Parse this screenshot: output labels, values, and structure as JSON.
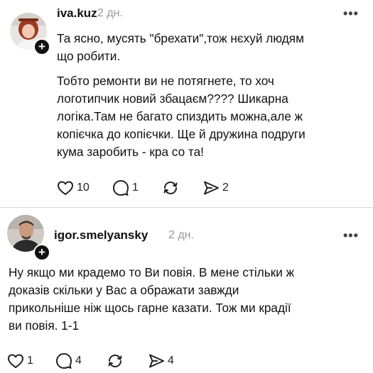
{
  "posts": [
    {
      "username": "iva.kuz",
      "time": "2 дн.",
      "more_label": "•••",
      "avatar_icon": "avatar-icon",
      "paragraphs": [
        [
          "Та ясно, мусять \"брехати\",тож нєхуй людям",
          "що робити."
        ],
        [
          "Тобто ремонти ви не потягнете, то хоч",
          "логотипчик новий збацаєм???? Шикарна",
          "логіка.Там не багато спиздить можна,але ж",
          "копієчка до копієчки. Ще й дружина подруги",
          "кума заробить - кра со та!"
        ]
      ],
      "likes": "10",
      "replies": "1",
      "reposts": "",
      "shares": "2"
    },
    {
      "username": "igor.smelyansky",
      "time": "2 дн.",
      "more_label": "•••",
      "avatar_icon": "avatar-icon",
      "paragraphs": [
        [
          "Ну якщо ми крадемо то Ви повія. В мене стільки ж",
          "доказів скільки у Вас а ображати завжди",
          "прикольніше ніж щось гарне казати. Тож ми крадії",
          "ви повія. 1-1"
        ]
      ],
      "likes": "1",
      "replies": "4",
      "reposts": "",
      "shares": "4"
    }
  ],
  "colors": {
    "text": "#111111",
    "muted": "#9a9a9a",
    "divider": "#d7d7d7",
    "badge": "#111111"
  }
}
